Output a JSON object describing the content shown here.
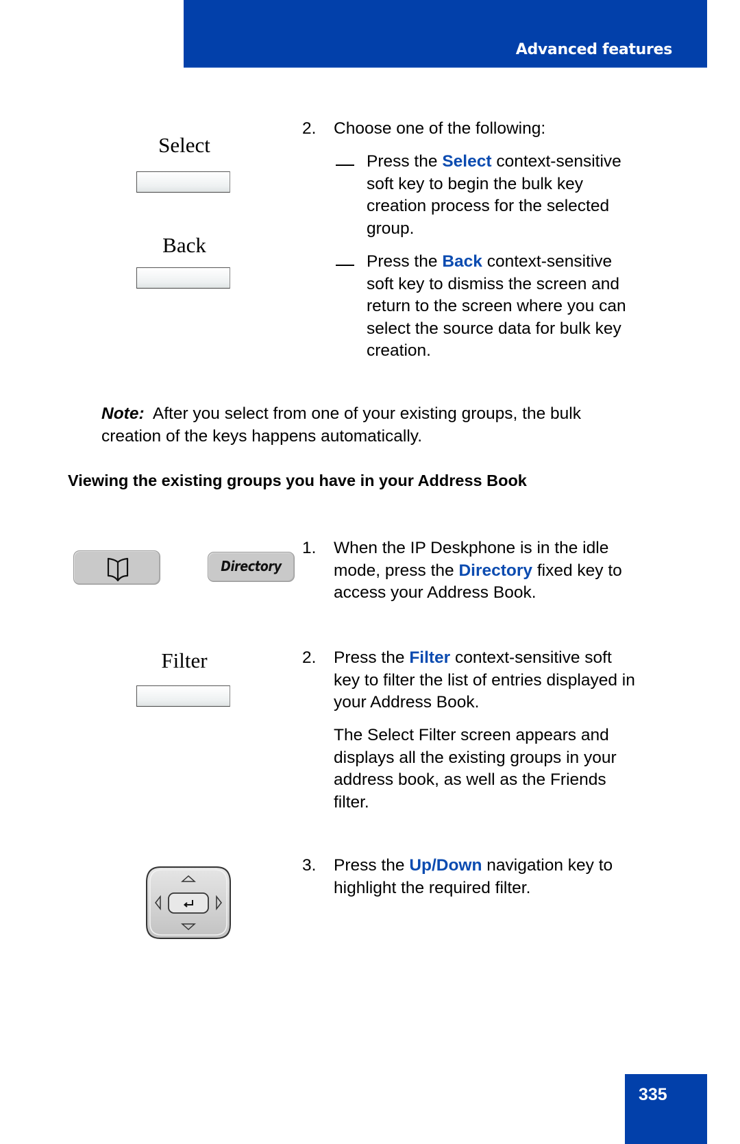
{
  "header": {
    "section_title": "Advanced features"
  },
  "footer": {
    "page_number": "335"
  },
  "colors": {
    "brand_blue": "#0240aa",
    "keyword_blue": "#0b4bb0"
  },
  "step_choose": {
    "number": "2.",
    "intro": "Choose one of the following:",
    "options": [
      {
        "prefix": "Press the ",
        "keyword": "Select",
        "lines": [
          "context-sensitive",
          "soft key to begin the bulk key",
          "creation process for the selected",
          "group."
        ]
      },
      {
        "prefix": "Press the ",
        "keyword": "Back",
        "lines": [
          "context-sensitive",
          "soft key to dismiss the screen and",
          "return to the screen where you can",
          "select the source data for bulk key",
          "creation."
        ]
      }
    ]
  },
  "softkeys": {
    "select": "Select",
    "back": "Back",
    "filter": "Filter"
  },
  "note": {
    "label": "Note:",
    "line1": "After you select from one of your existing groups, the bulk",
    "line2": "creation of the keys happens automatically."
  },
  "section": {
    "heading": "Viewing the existing groups you have in your Address Book",
    "directory_key_label": "Directory",
    "steps": [
      {
        "number": "1.",
        "line1": "When the IP Deskphone is in the idle",
        "line2_prefix": "mode, press the ",
        "keyword": "Directory",
        "line2_suffix": " fixed key to",
        "line3": "access your Address Book."
      },
      {
        "number": "2.",
        "line1_prefix": "Press the ",
        "keyword": "Filter",
        "line1_suffix": " context-sensitive soft",
        "line2": "key to filter the list of entries displayed in",
        "line3": "your Address Book.",
        "para": [
          "The Select Filter screen appears and",
          "displays all the existing groups in your",
          "address book, as well as the Friends",
          "filter."
        ]
      },
      {
        "number": "3.",
        "line1_prefix": "Press the ",
        "keyword": "Up/Down",
        "line1_suffix": " navigation key to",
        "line2": "highlight the required filter."
      }
    ]
  }
}
